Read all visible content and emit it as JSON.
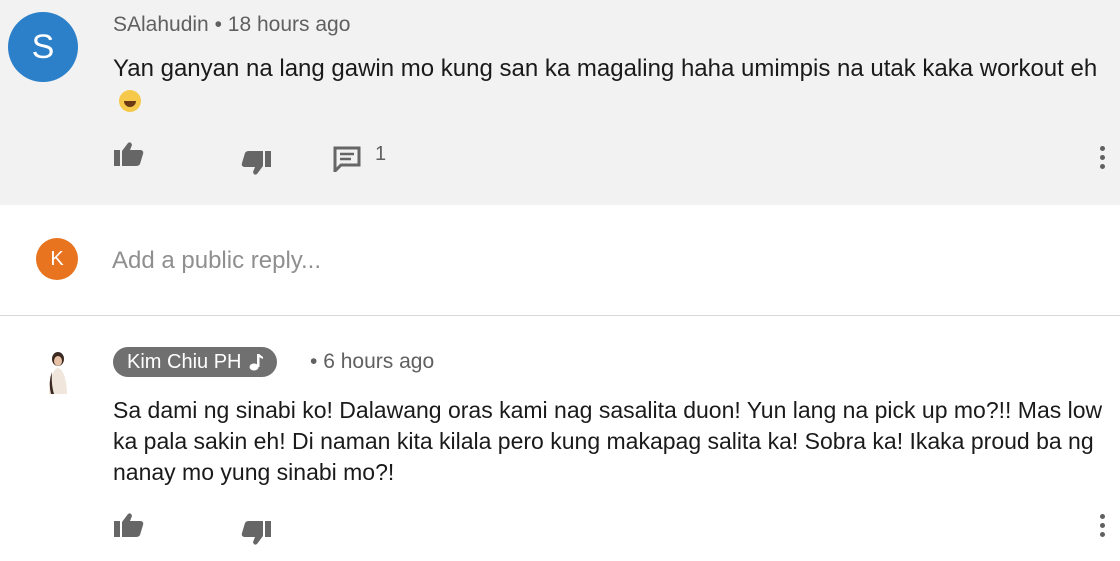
{
  "comment": {
    "avatar_letter": "S",
    "author": "SAlahudin",
    "time": "18 hours ago",
    "text": "Yan ganyan na lang gawin mo kung san ka magaling haha umimpis na utak kaka workout eh",
    "reply_count": "1"
  },
  "reply_box": {
    "avatar_letter": "K",
    "placeholder": "Add a public reply..."
  },
  "reply": {
    "author": "Kim Chiu PH",
    "time": "6 hours ago",
    "text": "Sa dami ng sinabi ko! Dalawang oras kami nag sasalita duon! Yun lang na pick up mo?!! Mas low ka pala sakin eh! Di naman kita kilala pero kung makapag salita ka! Sobra ka! Ikaka proud ba ng nanay mo yung sinabi mo?!"
  },
  "separator": "•",
  "colors": {
    "avatar_s": "#2c80c9",
    "avatar_k": "#e8741f",
    "badge": "#707070",
    "comment_bg": "#f2f2f2"
  },
  "icons": [
    "thumbs-up-icon",
    "thumbs-down-icon",
    "reply-icon",
    "more-vert-icon",
    "music-note-icon",
    "laughing-emoji-icon"
  ]
}
